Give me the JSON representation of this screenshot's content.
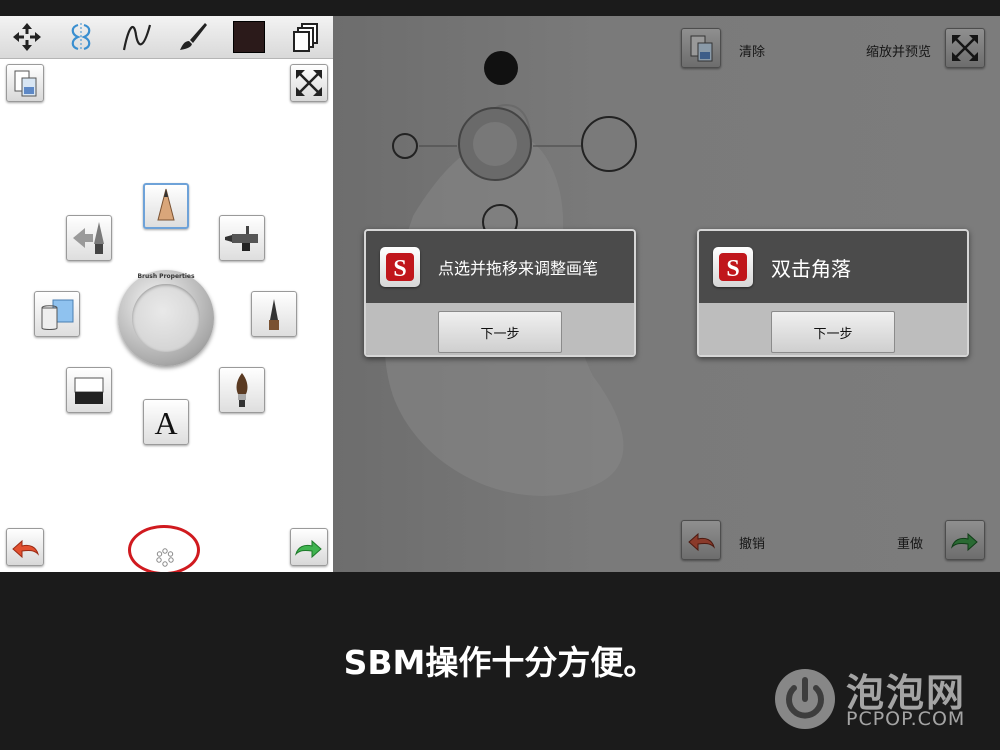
{
  "left_panel": {
    "toolbar": {
      "items": [
        {
          "icon": "move-icon"
        },
        {
          "icon": "symmetry-icon"
        },
        {
          "icon": "curve-icon"
        },
        {
          "icon": "brush-icon"
        },
        {
          "icon": "color-swatch-icon",
          "color": "#2b1a1a"
        },
        {
          "icon": "layers-icon"
        }
      ]
    },
    "puck_label": "Brush Properties"
  },
  "right_panel": {
    "clear_label": "清除",
    "zoom_preview_label": "缩放并预览",
    "undo_label": "撤销",
    "redo_label": "重做",
    "popup1": {
      "title": "点选并拖移来调整画笔",
      "button": "下一步"
    },
    "popup2": {
      "title": "双击角落",
      "button": "下一步"
    }
  },
  "caption": "SBM操作十分方便。",
  "watermark": {
    "text": "泡泡网",
    "sub": "PCPOP.COM"
  },
  "colors": {
    "highlight_ring": "#d01a1f",
    "active_tool_border": "#6ea2d8"
  }
}
